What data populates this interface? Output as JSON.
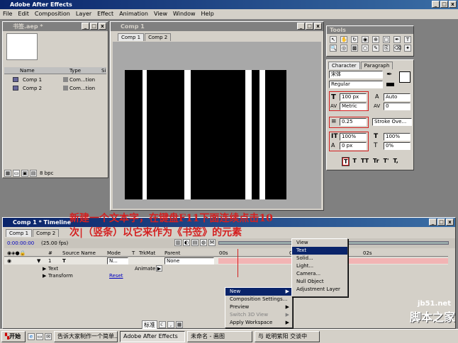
{
  "app_title": "Adobe After Effects",
  "menu": [
    "File",
    "Edit",
    "Composition",
    "Layer",
    "Effect",
    "Animation",
    "View",
    "Window",
    "Help"
  ],
  "project": {
    "title": "书签.aep *",
    "col_name": "Name",
    "col_type": "Type",
    "col_size": "Si",
    "items": [
      {
        "name": "Comp 1",
        "type": "Com...tion"
      },
      {
        "name": "Comp 2",
        "type": "Com...tion"
      }
    ],
    "bpc": "8 bpc"
  },
  "comp": {
    "title": "Comp 1",
    "tabs": [
      "Comp 1",
      "Comp 2"
    ],
    "bars": [
      {
        "x": 0.0,
        "w": 0.11
      },
      {
        "x": 0.135,
        "w": 0.235
      },
      {
        "x": 0.41,
        "w": 0.335
      },
      {
        "x": 0.785,
        "w": 0.05
      },
      {
        "x": 0.87,
        "w": 0.13
      }
    ]
  },
  "tools": {
    "title": "Tools"
  },
  "character": {
    "tabs": [
      "Character",
      "Paragraph"
    ],
    "font": "宋体",
    "style": "Regular",
    "size": "100 px",
    "leading": "Auto",
    "kerning": "Metric",
    "tracking": "0",
    "stroke_width": "0.25",
    "stroke_mode": "Stroke Ove...",
    "vscale": "100%",
    "hscale": "100%",
    "baseline": "0 px",
    "tsume": "0%",
    "format_labels": [
      "T",
      "T",
      "TT",
      "Tr",
      "T'",
      "T,"
    ]
  },
  "timeline": {
    "title": "Comp 1 * Timeline",
    "tabs": [
      "Comp 1",
      "Comp 2"
    ],
    "timecode": "0:00:00:00",
    "fps": "(25.00 fps)",
    "columns": {
      "num": "#",
      "source": "Source Name",
      "mode": "Mode",
      "t": "T",
      "trkmat": "TrkMat",
      "parent": "Parent"
    },
    "layer": {
      "num": "1",
      "type_icon": "T",
      "name": "",
      "mode": "N...",
      "parent": "None"
    },
    "text_row": "Text",
    "animate": "Animate:",
    "transform_row": "Transform",
    "reset": "Reset",
    "ruler": [
      "00s",
      "01s",
      "02s"
    ],
    "bottom_label": "标准"
  },
  "context_menu": {
    "items": [
      "New",
      "Composition Settings...",
      "Preview",
      "Switch 3D View",
      "Apply Workspace"
    ]
  },
  "submenu": {
    "items": [
      "View",
      "Text",
      "Solid...",
      "Light...",
      "Camera...",
      "Null Object",
      "Adjustment Layer"
    ]
  },
  "annotation": {
    "line1": "新建一个文本字，在键盘F11下面连续点击10",
    "line2": "次|（竖条）以它来作为《书签》的元素"
  },
  "watermark": {
    "site": "jb51.net",
    "name": "脚本之家"
  },
  "taskbar": {
    "start": "开始",
    "items": [
      "告诉大家制作一个简单...",
      "Adobe After Effects",
      "未命名 - 画图",
      "与 屹明紫阳 交谈中"
    ]
  }
}
